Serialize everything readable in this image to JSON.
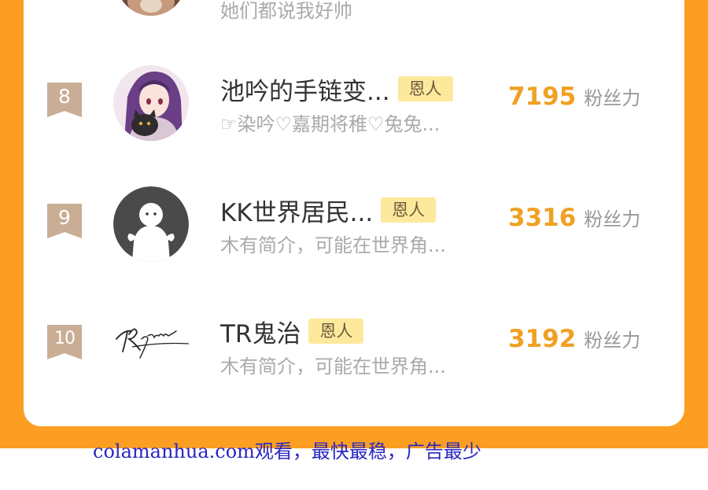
{
  "rows": [
    {
      "rank": "",
      "name": "",
      "tag": "",
      "desc": "她们都说我好帅",
      "score": "",
      "unit": "",
      "avatar": "partial-photo-avatar"
    },
    {
      "rank": "8",
      "name": "池吟的手链变...",
      "tag": "恩人",
      "desc": "☞染吟♡嘉期将稚♡兔兔...",
      "score": "7195",
      "unit": "粉丝力",
      "avatar": "anime-girl-cat-avatar"
    },
    {
      "rank": "9",
      "name": "KK世界居民...",
      "tag": "恩人",
      "desc": "木有简介，可能在世界角...",
      "score": "3316",
      "unit": "粉丝力",
      "avatar": "default-ghost-avatar"
    },
    {
      "rank": "10",
      "name": "TR鬼治",
      "tag": "恩人",
      "desc": "木有简介，可能在世界角...",
      "score": "3192",
      "unit": "粉丝力",
      "avatar": "signature-avatar"
    }
  ],
  "signature_text": "TRghost",
  "watermark": "colamanhua.com观看，最快最稳，广告最少",
  "colors": {
    "orange": "#fb9e21",
    "badge": "#c9ad95",
    "tag_bg": "#fde99c",
    "score": "#f0a023",
    "watermark": "#2a27c2"
  }
}
